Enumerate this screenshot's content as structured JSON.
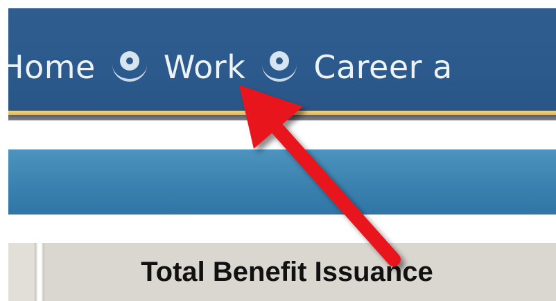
{
  "nav": {
    "items": [
      {
        "label": "Home"
      },
      {
        "label": "Work"
      },
      {
        "label": "Career a"
      }
    ],
    "separator_icon": "person-bubble-icon"
  },
  "table": {
    "header_title": "Total Benefit Issuance"
  },
  "annotation": {
    "type": "arrow",
    "color": "#e8141c",
    "points_to": "Work"
  },
  "colors": {
    "nav_background": "#2c5a8c",
    "nav_text": "#eef3f8",
    "accent_gold": "#e6b759",
    "sub_bar": "#3b82b0",
    "table_header_bg": "#dad6d0"
  }
}
